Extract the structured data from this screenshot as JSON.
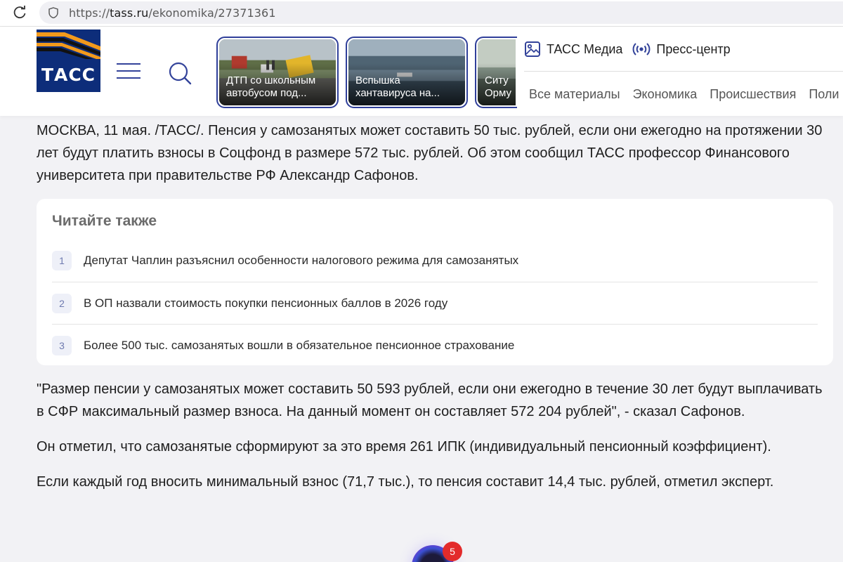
{
  "browser": {
    "url_scheme": "https://",
    "url_host": "tass.ru",
    "url_path": "/ekonomika/27371361"
  },
  "header": {
    "logo_text": "ТАСС",
    "stories": [
      {
        "caption_line1": "ДТП со школьным",
        "caption_line2": "автобусом под..."
      },
      {
        "caption_line1": "Вспышка",
        "caption_line2": "хантавируса на..."
      },
      {
        "caption_line1": "Ситу",
        "caption_line2": "Орму"
      }
    ],
    "top_links": [
      {
        "label": "ТАСС Медиа",
        "icon": "image-icon"
      },
      {
        "label": "Пресс-центр",
        "icon": "broadcast-icon"
      }
    ],
    "nav": [
      "Все материалы",
      "Экономика",
      "Происшествия",
      "Поли"
    ],
    "accent_color": "#2f3f9a",
    "logo_color": "#0d2d7a"
  },
  "article": {
    "lead": "МОСКВА, 11 мая. /ТАСС/. Пенсия у самозанятых может составить 50 тыс. рублей, если они ежегодно на протяжении 30 лет будут платить взносы в Соцфонд в размере 572 тыс. рублей. Об этом сообщил ТАСС профессор Финансового университета при правительстве РФ Александр Сафонов.",
    "read_also": {
      "title": "Читайте также",
      "items": [
        {
          "num": "1",
          "text": "Депутат Чаплин разъяснил особенности налогового режима для самозанятых"
        },
        {
          "num": "2",
          "text": "В ОП назвали стоимость покупки пенсионных баллов в 2026 году"
        },
        {
          "num": "3",
          "text": "Более 500 тыс. самозанятых вошли в обязательное пенсионное страхование"
        }
      ]
    },
    "paragraphs": [
      "\"Размер пенсии у самозанятых может составить 50 593 рублей, если они ежегодно в течение 30 лет будут выплачивать в СФР максимальный размер взноса. На данный момент он составляет 572 204 рублей\", - сказал Сафонов.",
      "Он отметил, что самозанятые сформируют за это время 261 ИПК (индивидуальный пенсионный коэффициент).",
      "Если каждый год вносить минимальный взнос (71,7 тыс.), то пенсия составит 14,4 тыс. рублей, отметил эксперт."
    ]
  },
  "assistant": {
    "badge_count": "5"
  }
}
